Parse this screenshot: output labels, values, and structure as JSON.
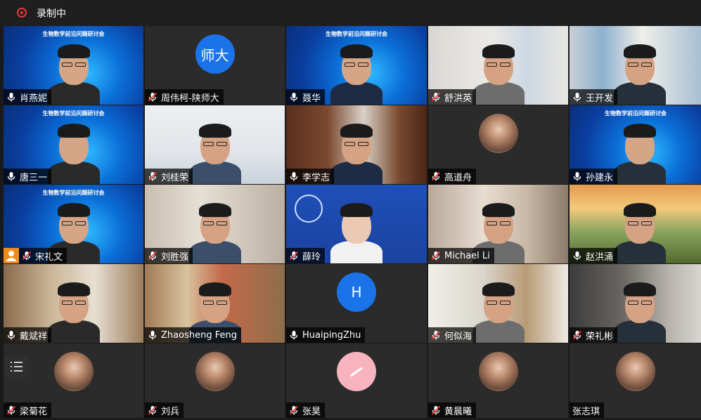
{
  "recording": {
    "label": "录制中"
  },
  "conference": {
    "title": "生物数学前沿问题研讨会"
  },
  "participants": [
    {
      "name": "肖燕妮",
      "muted": false,
      "bg": "banner"
    },
    {
      "name": "周伟柯-陕师大",
      "muted": true,
      "bg": "avatar",
      "avatar_text": "师大",
      "avatar_color": "#1a73e8"
    },
    {
      "name": "聂华",
      "muted": false,
      "bg": "banner"
    },
    {
      "name": "舒洪英",
      "muted": true,
      "bg": "room-light"
    },
    {
      "name": "王开发",
      "muted": false,
      "bg": "curtain"
    },
    {
      "name": "唐三一",
      "muted": false,
      "bg": "banner"
    },
    {
      "name": "刘桂荣",
      "muted": true,
      "bg": "office-white"
    },
    {
      "name": "李学志",
      "muted": false,
      "bg": "bookshelf-wood"
    },
    {
      "name": "高道舟",
      "muted": true,
      "bg": "avatar-photo"
    },
    {
      "name": "孙建永",
      "muted": false,
      "bg": "banner",
      "speaking": true
    },
    {
      "name": "宋礼文",
      "muted": true,
      "bg": "banner",
      "host_badge": true
    },
    {
      "name": "刘胜强",
      "muted": true,
      "bg": "office-beige"
    },
    {
      "name": "薛玲",
      "muted": true,
      "bg": "university-blue"
    },
    {
      "name": "Michael Li",
      "muted": true,
      "bg": "blur-warm"
    },
    {
      "name": "赵洪涌",
      "muted": false,
      "bg": "outdoor"
    },
    {
      "name": "戴斌祥",
      "muted": false,
      "bg": "bookshelf-light"
    },
    {
      "name": "Zhaosheng Feng",
      "muted": false,
      "bg": "bookshelf-color"
    },
    {
      "name": "HuaipingZhu",
      "muted": false,
      "bg": "avatar",
      "avatar_text": "H",
      "avatar_color": "#1a73e8"
    },
    {
      "name": "何似海",
      "muted": true,
      "bg": "bookshelf-bright"
    },
    {
      "name": "荣礼彬",
      "muted": true,
      "bg": "room-grey"
    },
    {
      "name": "梁菊花",
      "muted": true,
      "bg": "avatar-photo"
    },
    {
      "name": "刘兵",
      "muted": true,
      "bg": "avatar-photo"
    },
    {
      "name": "张昊",
      "muted": true,
      "bg": "avatar-pink"
    },
    {
      "name": "黄晨曦",
      "muted": true,
      "bg": "avatar-photo"
    },
    {
      "name": "张志琪",
      "muted": null,
      "bg": "avatar-photo"
    }
  ]
}
